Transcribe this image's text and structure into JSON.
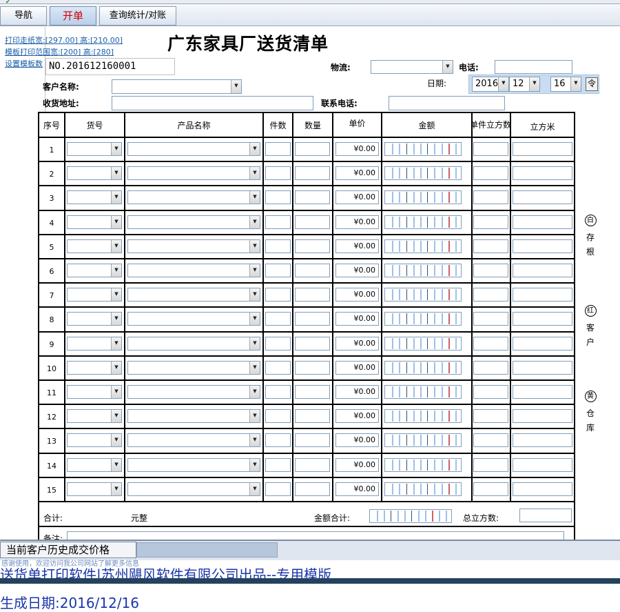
{
  "tabs": [
    {
      "label": "导航"
    },
    {
      "label": "开单"
    },
    {
      "label": "查询统计/对账"
    }
  ],
  "links": {
    "print_paper": "打印走纸宽:[297.00] 高:[210.00]",
    "template_range": "模板打印范围宽:[200] 高:[280]",
    "template_settings": "设置模板数"
  },
  "form": {
    "title": "广东家具厂送货清单",
    "order_no": "NO.201612160001",
    "logistics_label": "物流:",
    "phone_label": "电话:",
    "customer_label": "客户名称:",
    "date_label": "日期:",
    "address_label": "收货地址:",
    "contact_phone_label": "联系电话:",
    "date": {
      "year": "2016",
      "month": "12",
      "day": "16"
    },
    "spin_glyph": "令"
  },
  "table": {
    "headers": [
      "序号",
      "货号",
      "产品名称",
      "件数",
      "数量",
      "单价",
      "金额",
      "单件立方数",
      "立方米"
    ],
    "rows": [
      {
        "no": "1",
        "price": "¥0.00"
      },
      {
        "no": "2",
        "price": "¥0.00"
      },
      {
        "no": "3",
        "price": "¥0.00"
      },
      {
        "no": "4",
        "price": "¥0.00"
      },
      {
        "no": "5",
        "price": "¥0.00"
      },
      {
        "no": "6",
        "price": "¥0.00"
      },
      {
        "no": "7",
        "price": "¥0.00"
      },
      {
        "no": "8",
        "price": "¥0.00"
      },
      {
        "no": "9",
        "price": "¥0.00"
      },
      {
        "no": "10",
        "price": "¥0.00"
      },
      {
        "no": "11",
        "price": "¥0.00"
      },
      {
        "no": "12",
        "price": "¥0.00"
      },
      {
        "no": "13",
        "price": "¥0.00"
      },
      {
        "no": "14",
        "price": "¥0.00"
      },
      {
        "no": "15",
        "price": "¥0.00"
      }
    ],
    "total_label": "合计:",
    "yuan_label": "元整",
    "amount_total_label": "金额合计:",
    "total_cubic_label": "总立方数:",
    "remark_label": "备注:"
  },
  "side_copies": [
    {
      "color_char": "白",
      "chars": [
        "存",
        "根"
      ]
    },
    {
      "color_char": "红",
      "chars": [
        "客",
        "户"
      ]
    },
    {
      "color_char": "黄",
      "chars": [
        "仓",
        "库"
      ]
    }
  ],
  "bottom": {
    "history_label": "当前客户历史成交价格",
    "status_text": "感谢使用，欢迎访问我公司网站了解更多信息",
    "brand_text": "送货单打印软件|苏州飓风软件有限公司出品--专用模版",
    "generated_date": "生成日期:2016/12/16"
  }
}
